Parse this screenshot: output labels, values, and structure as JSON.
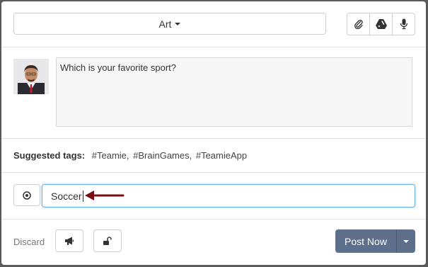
{
  "header": {
    "category_label": "Art",
    "tools": [
      "paperclip-icon",
      "google-drive-icon",
      "microphone-icon"
    ]
  },
  "compose": {
    "question_text": "Which is your favorite sport?"
  },
  "tags": {
    "label": "Suggested tags:",
    "items": [
      "#Teamie,",
      "#BrainGames,",
      "#TeamieApp"
    ]
  },
  "poll": {
    "option_value": "Soccer"
  },
  "footer": {
    "discard_label": "Discard",
    "post_label": "Post Now"
  },
  "colors": {
    "post_button": "#5e6f8c",
    "input_focus_border": "#66afe9",
    "annotation_arrow": "#7a0f12"
  }
}
